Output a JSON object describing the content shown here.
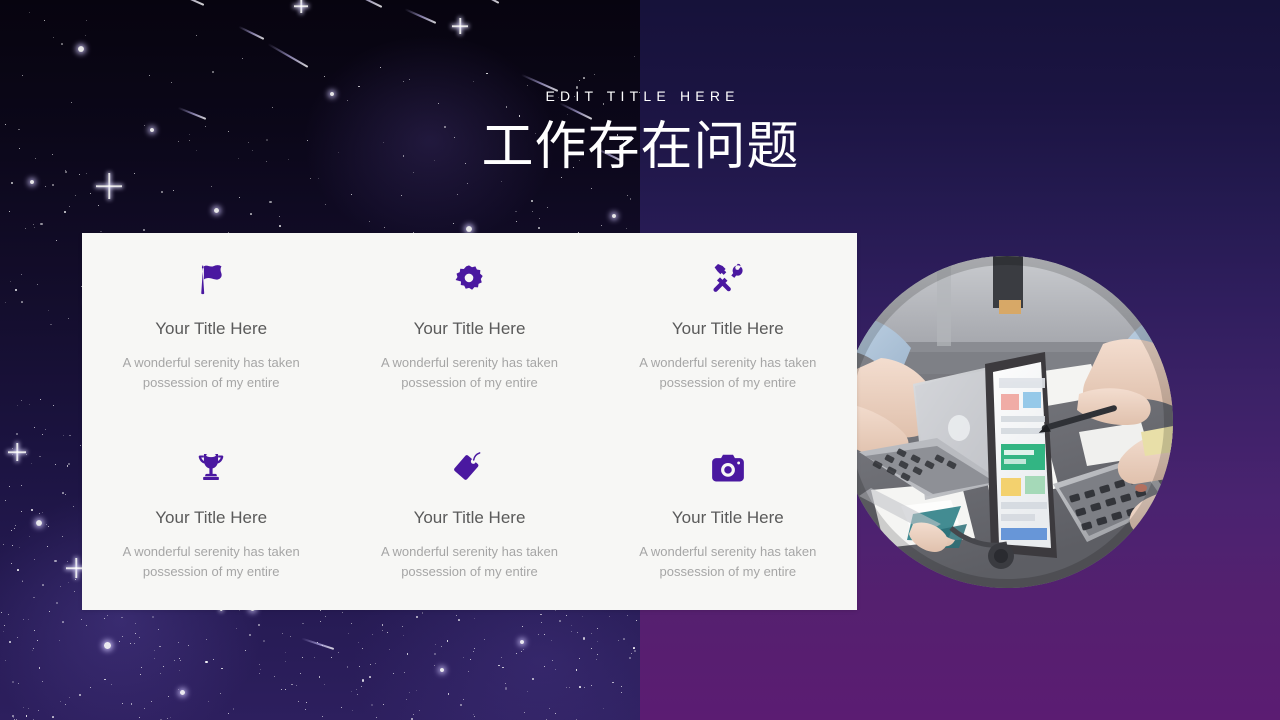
{
  "slide": {
    "eyebrow": "EDIT TITLE HERE",
    "title": "工作存在问题",
    "accent_color": "#4a18a0",
    "card_bg": "#f7f7f5",
    "bg_top_color": "#16123a",
    "bg_bottom_color": "#5b1c72",
    "starfield_color": "#0b0719"
  },
  "features": [
    {
      "icon": "flag-icon",
      "title": "Your Title Here",
      "desc": "A wonderful serenity has taken possession of my entire"
    },
    {
      "icon": "gear-icon",
      "title": "Your Title Here",
      "desc": "A wonderful serenity has taken possession of my entire"
    },
    {
      "icon": "tools-icon",
      "title": "Your Title Here",
      "desc": "A wonderful serenity has taken possession of my entire"
    },
    {
      "icon": "trophy-icon",
      "title": "Your Title Here",
      "desc": "A wonderful serenity has taken possession of my entire"
    },
    {
      "icon": "tag-icon",
      "title": "Your Title Here",
      "desc": "A wonderful serenity has taken possession of my entire"
    },
    {
      "icon": "camera-icon",
      "title": "Your Title Here",
      "desc": "A wonderful serenity has taken possession of my entire"
    }
  ],
  "photo": {
    "name": "team-working-on-laptops-photo",
    "alt": "Overhead view of people working on laptops at a desk"
  }
}
